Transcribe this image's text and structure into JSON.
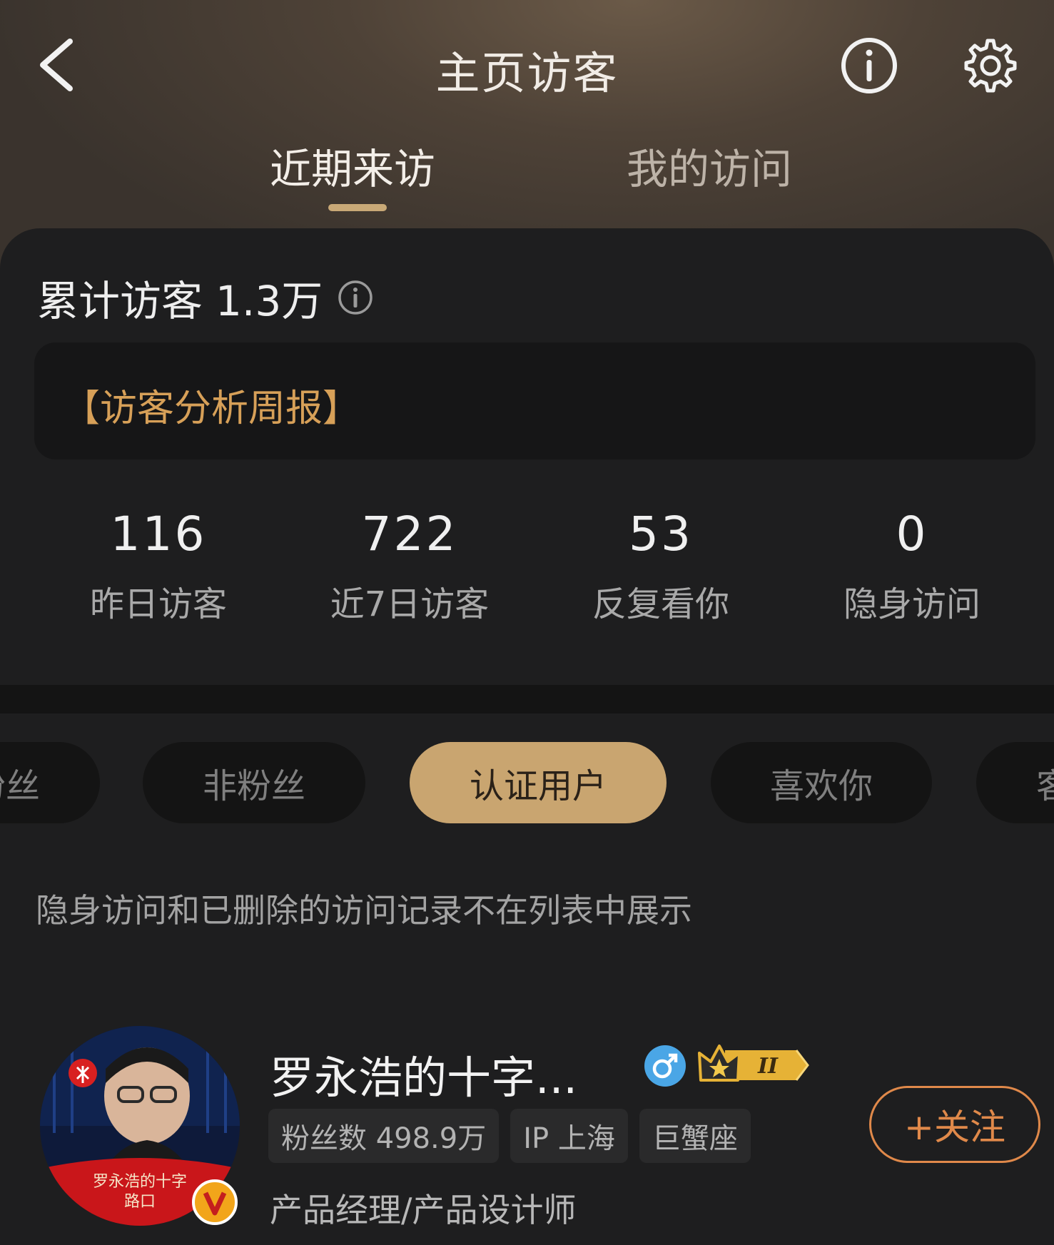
{
  "header": {
    "title": "主页访客"
  },
  "tabs": [
    {
      "label": "近期来访",
      "active": true
    },
    {
      "label": "我的访问",
      "active": false
    }
  ],
  "summary": {
    "total_label": "累计访客",
    "total_value": "1.3万",
    "report_label": "【访客分析周报】"
  },
  "stats": [
    {
      "value": "116",
      "label": "昨日访客"
    },
    {
      "value": "722",
      "label": "近7日访客"
    },
    {
      "value": "53",
      "label": "反复看你"
    },
    {
      "value": "0",
      "label": "隐身访问"
    }
  ],
  "filters": [
    {
      "label": "粉丝",
      "active": false
    },
    {
      "label": "非粉丝",
      "active": false
    },
    {
      "label": "认证用户",
      "active": true
    },
    {
      "label": "喜欢你",
      "active": false
    },
    {
      "label": "客",
      "active": false
    }
  ],
  "notice": "隐身访问和已删除的访问记录不在列表中展示",
  "visitor": {
    "name": "罗永浩的十字...",
    "gender": "male",
    "level_badge": "II",
    "tags": [
      "粉丝数 498.9万",
      "IP 上海",
      "巨蟹座"
    ],
    "bio": "产品经理/产品设计师",
    "follow_label": "+关注",
    "avatar_caption": "罗永浩的十字路口"
  },
  "colors": {
    "accent_gold": "#c9a570",
    "report_orange": "#d7a058",
    "follow_orange": "#e0894a",
    "gender_blue": "#4aa6e6"
  }
}
